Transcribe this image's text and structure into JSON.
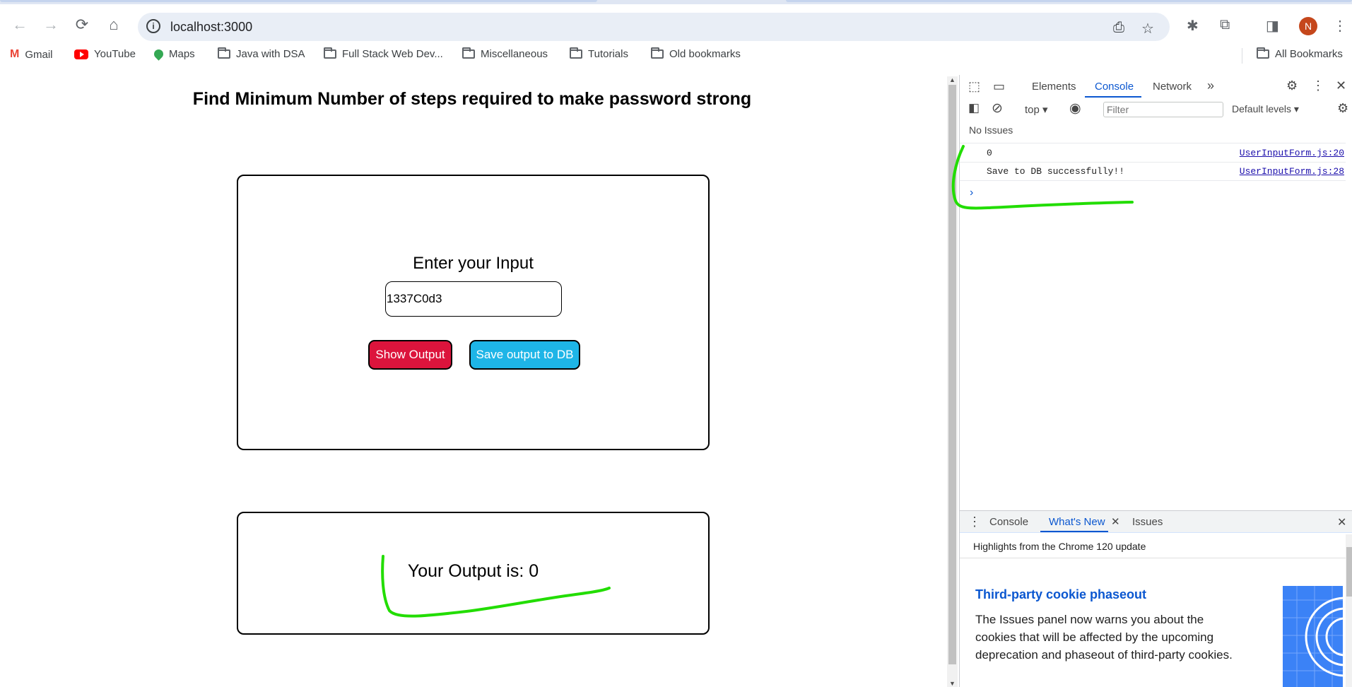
{
  "browser": {
    "url": "localhost:3000",
    "avatar_initial": "N",
    "bookmarks": [
      "Gmail",
      "YouTube",
      "Maps",
      "Java with DSA",
      "Full Stack Web Dev...",
      "Miscellaneous",
      "Tutorials",
      "Old bookmarks"
    ],
    "all_bookmarks": "All Bookmarks"
  },
  "page": {
    "title": "Find Minimum Number of steps required to make password strong",
    "input_label": "Enter your Input",
    "input_value": "1337C0d3",
    "show_output_label": "Show Output",
    "save_output_label": "Save output to DB",
    "output_text": "Your Output is: 0",
    "colors": {
      "show_button": "#dc143c",
      "save_button": "#1eb5e7",
      "annotation": "#22dd00"
    }
  },
  "devtools": {
    "tabs": [
      "Elements",
      "Console",
      "Network"
    ],
    "active_tab": "Console",
    "context": "top",
    "filter_placeholder": "Filter",
    "levels": "Default levels",
    "issues": "No Issues",
    "logs": [
      {
        "message": "0",
        "source": "UserInputForm.js:20"
      },
      {
        "message": "Save to DB successfully!!",
        "source": "UserInputForm.js:28"
      }
    ],
    "drawer": {
      "tabs": [
        "Console",
        "What's New",
        "Issues"
      ],
      "active_tab": "What's New",
      "subtitle": "Highlights from the Chrome 120 update",
      "heading": "Third-party cookie phaseout",
      "body": "The Issues panel now warns you about the cookies that will be affected by the upcoming deprecation and phaseout of third-party cookies."
    }
  }
}
